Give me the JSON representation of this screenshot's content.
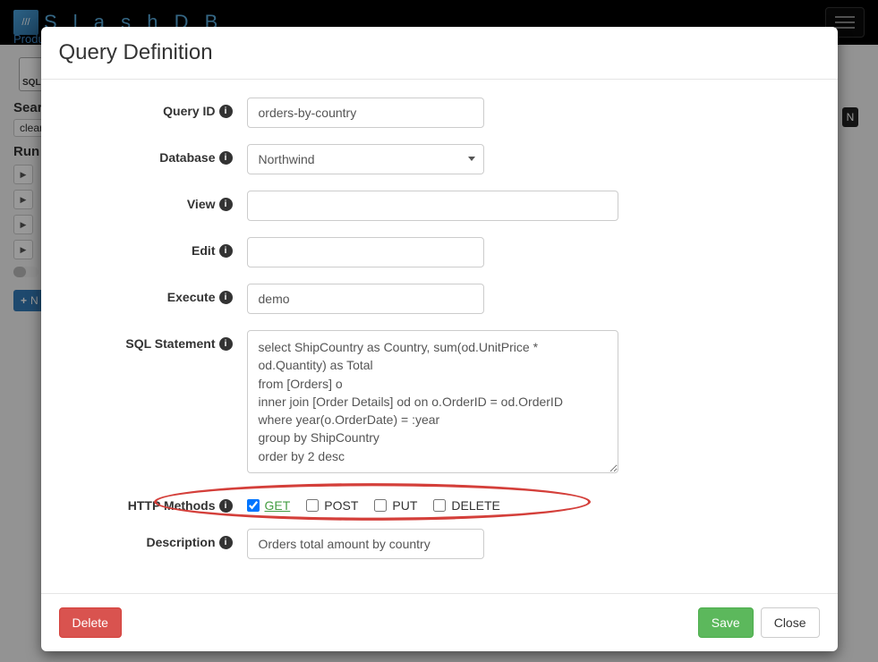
{
  "navbar": {
    "brand": "S l a s h D B",
    "menu_label": "Produ"
  },
  "bg": {
    "sql_icon_label": "SQL",
    "search_label": "Searc",
    "clear_btn": "clear",
    "run_label": "Run",
    "new_btn": "N",
    "n_text": "N"
  },
  "modal": {
    "title": "Query Definition",
    "labels": {
      "query_id": "Query ID",
      "database": "Database",
      "view": "View",
      "edit": "Edit",
      "execute": "Execute",
      "sql": "SQL Statement",
      "http": "HTTP Methods",
      "description": "Description"
    },
    "values": {
      "query_id": "orders-by-country",
      "database": "Northwind",
      "view": "",
      "edit": "",
      "execute": "demo",
      "sql": "select ShipCountry as Country, sum(od.UnitPrice * od.Quantity) as Total\nfrom [Orders] o\ninner join [Order Details] od on o.OrderID = od.OrderID\nwhere year(o.OrderDate) = :year\ngroup by ShipCountry\norder by 2 desc",
      "description": "Orders total amount by country"
    },
    "http_methods": {
      "get": {
        "label": "GET",
        "checked": true
      },
      "post": {
        "label": "POST",
        "checked": false
      },
      "put": {
        "label": "PUT",
        "checked": false
      },
      "delete": {
        "label": "DELETE",
        "checked": false
      }
    },
    "buttons": {
      "delete": "Delete",
      "save": "Save",
      "close": "Close"
    }
  }
}
